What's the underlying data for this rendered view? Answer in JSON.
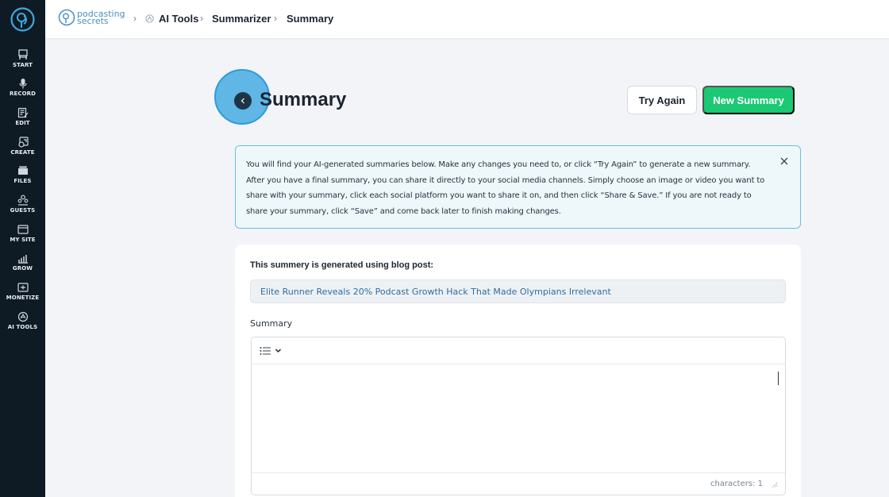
{
  "sidebar": {
    "logo_icon": "podcasting-secrets-logo",
    "items": [
      {
        "label": "START",
        "icon": "start-icon"
      },
      {
        "label": "RECORD",
        "icon": "microphone-icon"
      },
      {
        "label": "EDIT",
        "icon": "edit-icon"
      },
      {
        "label": "CREATE",
        "icon": "create-icon"
      },
      {
        "label": "FILES",
        "icon": "files-icon"
      },
      {
        "label": "GUESTS",
        "icon": "guests-icon"
      },
      {
        "label": "MY SITE",
        "icon": "my-site-icon"
      },
      {
        "label": "GROW",
        "icon": "grow-icon"
      },
      {
        "label": "MONETIZE",
        "icon": "monetize-icon"
      },
      {
        "label": "AI TOOLS",
        "icon": "ai-tools-icon"
      }
    ]
  },
  "topbar": {
    "brand_line1": "podcasting",
    "brand_line2": "secrets",
    "breadcrumb": [
      "AI Tools",
      "Summarizer",
      "Summary"
    ]
  },
  "page": {
    "title": "Summary",
    "try_again_label": "Try Again",
    "new_summary_label": "New Summary"
  },
  "info": {
    "text": "You will find your AI-generated summaries below. Make any changes you need to, or click “Try Again” to generate a new summary. After you have a final summary, you can share it directly to your social media channels. Simply choose an image or video you want to share with your summary, click each social platform you want to share it on, and then click “Share & Save.” If you are not ready to share your summary, click “Save” and come back later to finish making changes."
  },
  "card": {
    "source_label": "This summery is generated using blog post:",
    "source_title": "Elite Runner Reveals 20% Podcast Growth Hack That Made Olympians Irrelevant",
    "summary_label": "Summary",
    "char_count": "characters: 1"
  },
  "colors": {
    "sidebar_bg": "#0e1a24",
    "accent_green": "#1bc974",
    "info_border": "#66c2dd",
    "link_blue": "#2e6ea1"
  }
}
